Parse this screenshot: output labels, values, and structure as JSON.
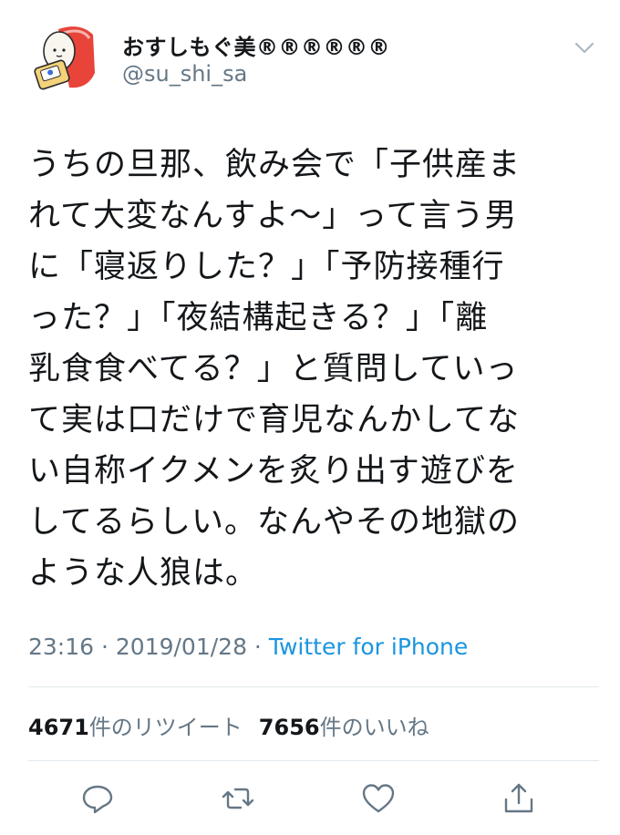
{
  "user": {
    "display_name": "おすしもぐ美®︎®︎®︎®︎®︎®︎",
    "handle": "@su_shi_sa",
    "avatar_icon": "sushi-character-icon"
  },
  "tweet": {
    "lines": [
      "うちの旦那、飲み会で「子供産ま",
      "れて大変なんすよ〜」って言う男",
      "に「寝返りした？」「予防接種行",
      "った？」「夜結構起きる？」「離",
      "乳食食べてる？」と質問していっ",
      "て実は口だけで育児なんかしてな",
      "い自称イクメンを炙り出す遊びを",
      "してるらしい。なんやその地獄の",
      "ような人狼は。"
    ],
    "time": "23:16",
    "separator": " · ",
    "date": "2019/01/28",
    "source": "Twitter for iPhone"
  },
  "stats": {
    "retweets_count": "4671",
    "retweets_label": "件のリツイート",
    "likes_count": "7656",
    "likes_label": "件のいいね"
  },
  "actions": {
    "icons": [
      "reply-icon",
      "retweet-icon",
      "like-icon",
      "share-icon"
    ]
  },
  "colors": {
    "text": "#14171a",
    "secondary": "#657786",
    "link": "#1b95e0",
    "divider": "#e1e8ed"
  }
}
